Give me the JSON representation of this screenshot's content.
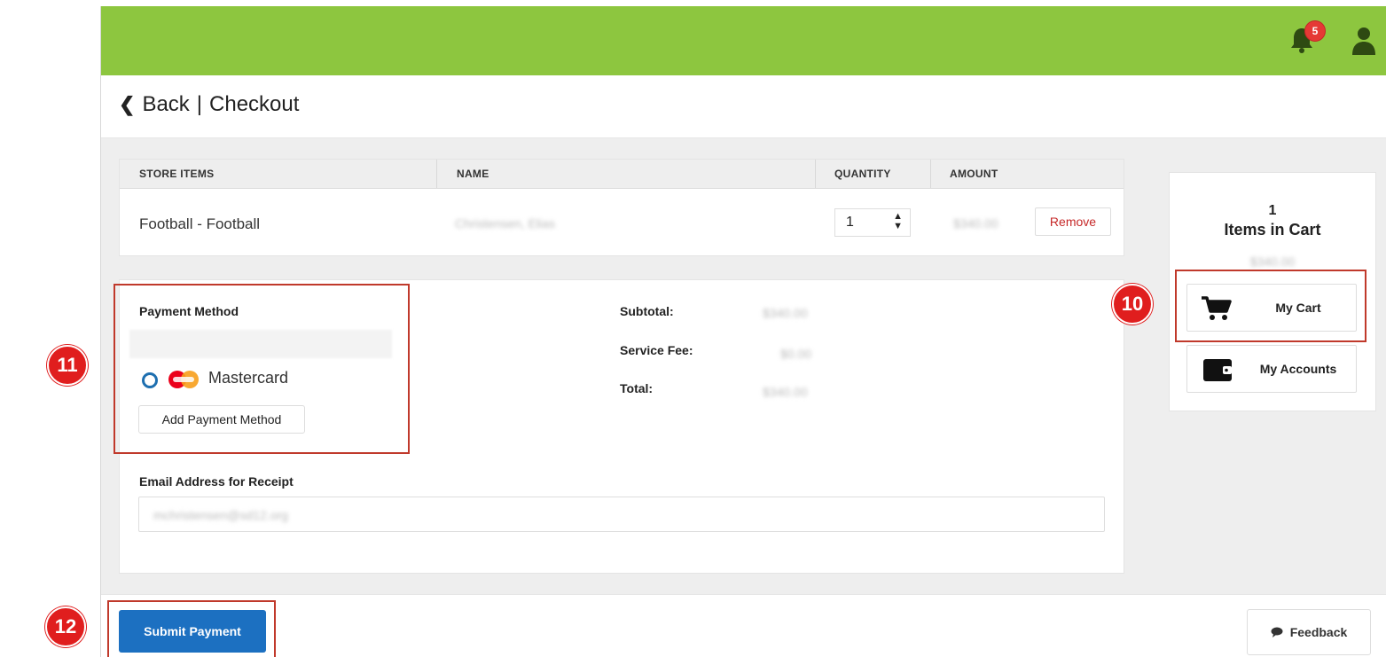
{
  "header": {
    "notification_count": "5",
    "back_label": "Back",
    "separator": "|",
    "page_title": "Checkout"
  },
  "table": {
    "columns": [
      "STORE ITEMS",
      "NAME",
      "QUANTITY",
      "AMOUNT"
    ],
    "rows": [
      {
        "item": "Football - Football",
        "name": "Christensen, Elias",
        "quantity": "1",
        "amount": "$340.00",
        "action": "Remove"
      }
    ]
  },
  "payment": {
    "section_label": "Payment Method",
    "card_name": "Mastercard",
    "add_button": "Add Payment Method",
    "email_label": "Email Address for Receipt",
    "email_value": "mchristensen@sd12.org"
  },
  "summary": {
    "subtotal_label": "Subtotal:",
    "subtotal_value": "$340.00",
    "fee_label": "Service Fee:",
    "fee_value": "$0.00",
    "total_label": "Total:",
    "total_value": "$340.00"
  },
  "cart_panel": {
    "count": "1",
    "label": "Items in Cart",
    "amount": "$340.00",
    "my_cart": "My Cart",
    "my_accounts": "My Accounts"
  },
  "footer": {
    "submit": "Submit Payment",
    "feedback": "Feedback"
  },
  "markers": {
    "cart": "10",
    "payment": "11",
    "submit": "12"
  },
  "colors": {
    "topbar": "#8dc63f",
    "primary": "#1c70c1",
    "marker": "#e01e1e",
    "highlight": "#c0392b"
  }
}
